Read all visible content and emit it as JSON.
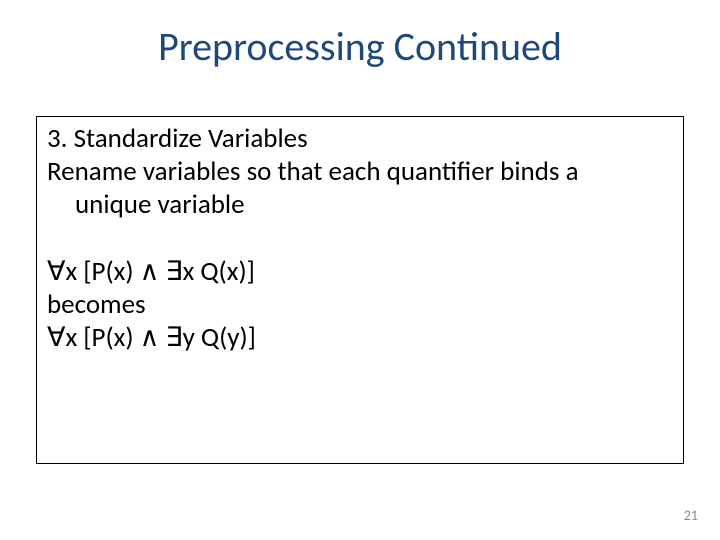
{
  "title": "Preprocessing Continued",
  "body": {
    "heading": "3. Standardize Variables",
    "desc_line1": "Rename variables so that each quantifier binds a",
    "desc_line2": "unique variable",
    "formula_before": "∀x [P(x) ∧ ∃x Q(x)]",
    "becomes": "becomes",
    "formula_after": "∀x [P(x) ∧ ∃y Q(y)]"
  },
  "page_number": "21"
}
